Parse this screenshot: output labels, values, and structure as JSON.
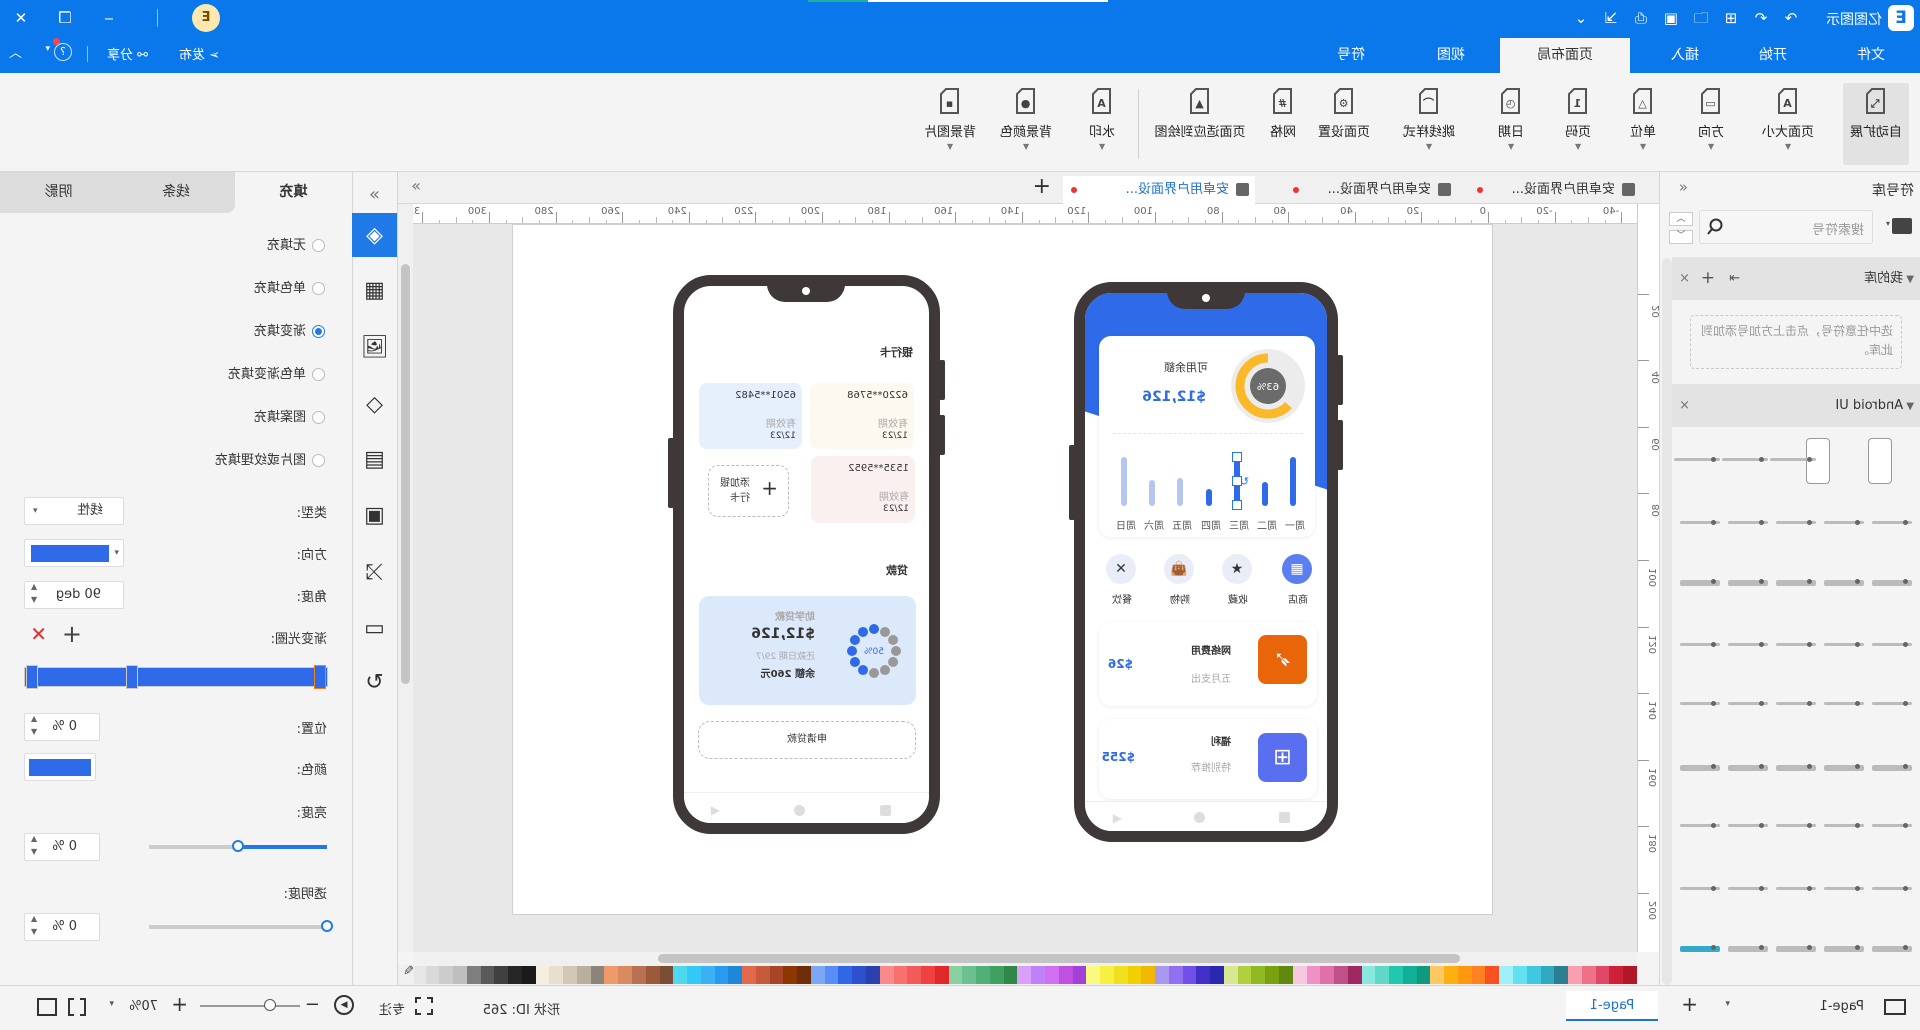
{
  "app": {
    "title": "亿图图示",
    "logo_letter": "E",
    "badge_letter": "E"
  },
  "titlebar": {
    "quick_icons": [
      "redo-icon",
      "undo-icon",
      "new-icon",
      "open-icon",
      "save-icon",
      "print-icon",
      "export-icon",
      "more-icon"
    ]
  },
  "menu": {
    "tabs": [
      "文件",
      "开始",
      "插入",
      "页面布局",
      "视图",
      "符号"
    ],
    "active_index": 3,
    "publish": "发布",
    "share": "分享"
  },
  "ribbon": {
    "buttons": [
      {
        "label": "自动扩展",
        "icon": "auto-expand-icon",
        "glyph": "⤡",
        "dropdown": false,
        "active": true
      },
      {
        "label": "页面大小",
        "icon": "page-size-icon",
        "glyph": "A",
        "dropdown": true
      },
      {
        "label": "方向",
        "icon": "orientation-icon",
        "glyph": "▭",
        "dropdown": true
      },
      {
        "label": "单位",
        "icon": "unit-icon",
        "glyph": "△",
        "dropdown": true
      },
      {
        "label": "页码",
        "icon": "page-number-icon",
        "glyph": "1",
        "dropdown": true
      },
      {
        "label": "日期",
        "icon": "date-icon",
        "glyph": "◷",
        "dropdown": true
      },
      {
        "label": "跳线样式",
        "icon": "jump-line-icon",
        "glyph": "⌒",
        "dropdown": true
      },
      {
        "label": "页面设置",
        "icon": "page-setup-icon",
        "glyph": "⚙",
        "dropdown": false
      },
      {
        "label": "网格",
        "icon": "grid-icon",
        "glyph": "#",
        "dropdown": false
      },
      {
        "label": "页面适应到绘图",
        "icon": "fit-to-drawing-icon",
        "glyph": "▲",
        "dropdown": false
      },
      {
        "label": "水印",
        "icon": "watermark-icon",
        "glyph": "A",
        "dropdown": true
      },
      {
        "label": "背景颜色",
        "icon": "background-color-icon",
        "glyph": "●",
        "dropdown": true
      },
      {
        "label": "背景图片",
        "icon": "background-image-icon",
        "glyph": "▪",
        "dropdown": true
      }
    ]
  },
  "doc_tabs": [
    {
      "label": "安卓用户界面设...",
      "unsaved": true
    },
    {
      "label": "安卓用户界面设...",
      "unsaved": true
    },
    {
      "label": "安卓用户界面设...",
      "unsaved": true,
      "active": true
    }
  ],
  "rulers": {
    "horizontal": [
      -40,
      -20,
      0,
      20,
      40,
      60,
      80,
      100,
      120,
      140,
      160,
      180,
      200,
      220,
      240,
      260,
      280,
      300,
      320
    ],
    "vertical": [
      20,
      40,
      60,
      80,
      100,
      120,
      140,
      160,
      180,
      200
    ]
  },
  "phone_dashboard": {
    "balance_label": "可用余额",
    "balance": "$12,126",
    "donut_percent": 63,
    "donut_label": "63%",
    "bars": [
      {
        "day": "周一",
        "level": 1.0,
        "active": true
      },
      {
        "day": "周二",
        "level": 0.49,
        "active": true
      },
      {
        "day": "周三",
        "level": 1.0,
        "active": true,
        "selected": true
      },
      {
        "day": "周四",
        "level": 0.35,
        "active": true
      },
      {
        "day": "周五",
        "level": 0.57,
        "active": false
      },
      {
        "day": "周六",
        "level": 0.53,
        "active": false
      },
      {
        "day": "周日",
        "level": 1.0,
        "active": false
      }
    ],
    "shortcuts": [
      {
        "label": "商店",
        "icon": "store-icon"
      },
      {
        "label": "收藏",
        "icon": "star-icon"
      },
      {
        "label": "购物",
        "icon": "shopping-bag-icon"
      },
      {
        "label": "餐饮",
        "icon": "utensils-icon"
      }
    ],
    "items": [
      {
        "title": "网络费用",
        "subtitle": "五月支出",
        "amount": "$26",
        "icon": "rocket-icon",
        "color": "#e8650a"
      },
      {
        "title": "福利",
        "subtitle": "特别推荐",
        "amount": "$255",
        "icon": "gift-icon",
        "color": "#5a6ff0"
      }
    ]
  },
  "phone_bank": {
    "cards_title": "银行卡",
    "cards": [
      {
        "number": "6220**5768",
        "expiry_label": "有效期",
        "expiry": "12/23",
        "color": "#fdf8f0"
      },
      {
        "number": "6501**5482",
        "expiry_label": "有效期",
        "expiry": "12/23",
        "color": "#e6effc"
      },
      {
        "number": "1535**5952",
        "expiry_label": "有效期",
        "expiry": "12/23",
        "color": "#fbf0f0"
      }
    ],
    "add_card": "添加银行卡",
    "loan_title": "贷款",
    "loan": {
      "name": "助学贷款",
      "amount": "$12,126",
      "due": "还款日期 29/7",
      "balance": "余额  260元",
      "progress_label": "50%",
      "progress": 0.5
    },
    "apply": "申请贷款"
  },
  "palette": [
    "#ffffff",
    "#e6e6e6",
    "#d9d9d9",
    "#cccccc",
    "#bfbfbf",
    "#7f7f7f",
    "#595959",
    "#404040",
    "#262626",
    "#1a1a1a",
    "#f5efe0",
    "#e8dfcc",
    "#d0c8b4",
    "#b8b09c",
    "#8c8478",
    "#ef9a6a",
    "#d98a5f",
    "#b87050",
    "#9c5a3c",
    "#7a4e35",
    "#4dd8f0",
    "#33c8f5",
    "#3ab0f5",
    "#2a9af0",
    "#1e88d8",
    "#e06a4a",
    "#c85a3c",
    "#a84428",
    "#8c3600",
    "#6e2c08",
    "#7aa8f5",
    "#5a8cf5",
    "#3066e8",
    "#2c50d0",
    "#2840b0",
    "#fa8a8a",
    "#fa7070",
    "#f55a5a",
    "#f04040",
    "#e02828",
    "#8ad0a0",
    "#6ac090",
    "#50b078",
    "#40a060",
    "#308848",
    "#d8a0f8",
    "#c080f8",
    "#d070f0",
    "#c050e0",
    "#a040d8",
    "#fafa80",
    "#f8f040",
    "#f0e020",
    "#f0d000",
    "#f0b800",
    "#a898f0",
    "#9070f0",
    "#7050e8",
    "#4030c8",
    "#2828b0",
    "#d8e890",
    "#b0d040",
    "#90b820",
    "#78a010",
    "#608810",
    "#f8c8e0",
    "#f090c8",
    "#e070a8",
    "#c05088",
    "#a02860",
    "#88e8e0",
    "#60d8c8",
    "#20c8b0",
    "#10b098",
    "#109880",
    "#ffc860",
    "#ffb010",
    "#ff9810",
    "#ff8020",
    "#f85020",
    "#a0f0f8",
    "#60e0f0",
    "#40c8e0",
    "#30a8c0",
    "#2a8090",
    "#f8a0b0",
    "#f07088",
    "#e04868",
    "#d02038",
    "#b01828"
  ],
  "library": {
    "title": "符号库",
    "search_placeholder": "搜索符号",
    "my_library": "我的库",
    "my_library_hint": "选中任意符号，点击上方加号添加到此库。",
    "android_ui": "Android UI"
  },
  "props": {
    "tabs": [
      "填充",
      "线条",
      "阴影"
    ],
    "active_tab": 0,
    "fill_options": [
      "无填充",
      "单色填充",
      "渐变填充",
      "单色渐变填充",
      "图案填充",
      "图片或纹理填充"
    ],
    "selected_fill": 2,
    "type_label": "类型:",
    "type_value": "线性",
    "direction_label": "方向:",
    "direction_color": "#2f6ae8",
    "angle_label": "角度:",
    "angle_value": "90 deg",
    "stops_label": "渐变光圈:",
    "position_label": "位置:",
    "position_value": "0 %",
    "color_label": "颜色:",
    "color_value": "#2f6ae8",
    "brightness_label": "亮度:",
    "brightness_value": "0 %",
    "brightness_level": 0.5,
    "transparency_label": "透明度:",
    "transparency_value": "0 %",
    "transparency_level": 0
  },
  "status": {
    "page_menu": "Page-1",
    "page_tab": "Page-1",
    "shape_id": "形状 ID: 265",
    "focus": "专注",
    "zoom": "70%",
    "zoom_level": 0.3
  }
}
